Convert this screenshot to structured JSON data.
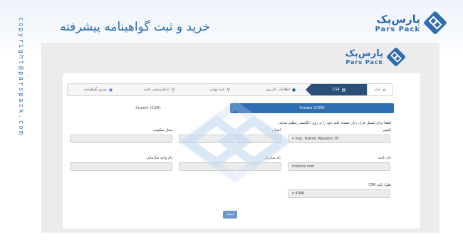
{
  "page": {
    "hero_title": "خرید و ثبت گواهینامه پیشرفته",
    "side_text": "copyright@parspack.com"
  },
  "brand": {
    "name_fa": "پارس‌پک",
    "name_en": "Pars Pack"
  },
  "wizard": {
    "steps": [
      {
        "label": "خانه",
        "icon": "home-icon"
      },
      {
        "label": "CSR",
        "icon": "file-icon"
      },
      {
        "label": "اطلاعات کاربری",
        "icon": "user-icon"
      },
      {
        "label": "تایید نهایی",
        "icon": "search-icon"
      },
      {
        "label": "اعتبارسنجی دامنه",
        "icon": "search-icon"
      },
      {
        "label": "صدور گواهینامه",
        "icon": "globe-icon"
      }
    ]
  },
  "tabs": {
    "create": "Create (CSR)",
    "import": "Import (CSR)"
  },
  "form": {
    "instruction": "لطفا برای تکمیل فرم، زبان صفحه کلید خود را بر روی انگلیسی تنظیم نمایید.",
    "country_label": "کشور",
    "country_value": "Iran, Islamic Republic Of",
    "state_label": "استان",
    "state_value": "",
    "city_label": "محل سکونت",
    "city_value": "",
    "domain_label": "نام دامنه",
    "domain_value": "mahisis.com",
    "org_label": "نام سازمان",
    "org_value": "",
    "unit_label": "نام واحد سازمانی",
    "unit_value": "",
    "keylength_label": "طول کلید CSR",
    "keylength_value": "4096",
    "submit_label": "ارسال"
  },
  "colors": {
    "accent": "#2f6db3",
    "active_step": "#2a4f78",
    "submit": "#6a98c9"
  }
}
